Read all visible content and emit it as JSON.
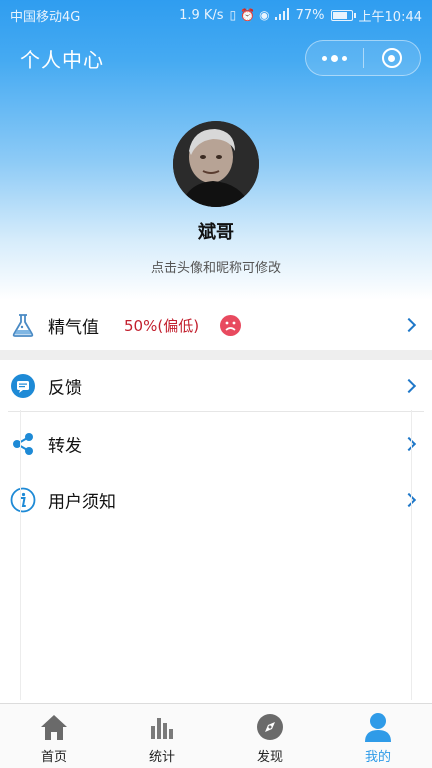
{
  "status_bar": {
    "carrier": "中国移动4G",
    "speed": "1.9 K/s",
    "battery": "77%",
    "battery_level": 0.77,
    "time": "上午10:44",
    "icons": [
      "vibrate-icon",
      "alarm-icon",
      "eye-icon",
      "signal-icon",
      "battery-icon"
    ]
  },
  "nav": {
    "title": "个人中心",
    "menu_icon": "more-dots-icon",
    "close_icon": "target-circle-icon"
  },
  "profile": {
    "name": "斌哥",
    "hint": "点击头像和昵称可修改",
    "avatar_icon": "avatar"
  },
  "energy": {
    "label": "精气值",
    "value": "50%(偏低)",
    "icon": "flask-icon",
    "mood_icon": "sad-face-icon",
    "colors": {
      "value": "#c2202e",
      "mood": "#e84a5f"
    }
  },
  "menu": [
    {
      "label": "反馈",
      "icon": "feedback-icon"
    },
    {
      "label": "转发",
      "icon": "share-icon"
    },
    {
      "label": "用户须知",
      "icon": "info-icon"
    }
  ],
  "tabs": [
    {
      "label": "首页",
      "icon": "home-icon",
      "active": false
    },
    {
      "label": "统计",
      "icon": "stats-icon",
      "active": false
    },
    {
      "label": "发现",
      "icon": "compass-icon",
      "active": false
    },
    {
      "label": "我的",
      "icon": "user-icon",
      "active": true
    }
  ],
  "colors": {
    "brand": "#2f9df0",
    "accent": "#1f78c9",
    "tab_active": "#2f9be8",
    "tab_inactive": "#666666"
  }
}
